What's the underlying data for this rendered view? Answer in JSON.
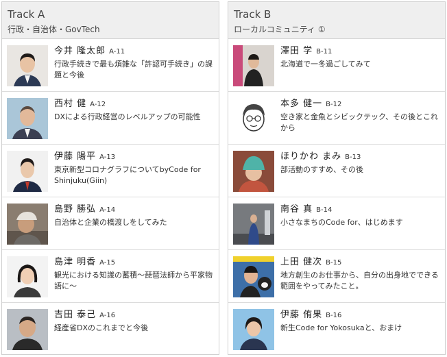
{
  "tracks": [
    {
      "title": "Track A",
      "subtitle": "行政・自治体・GovTech",
      "talks": [
        {
          "name": "今井 隆太郎",
          "code": "A-11",
          "title": "行政手続きで最も煩雑な「許認可手続き」の課題と今後"
        },
        {
          "name": "西村 健",
          "code": "A-12",
          "title": "DXによる行政経営のレベルアップの可能性"
        },
        {
          "name": "伊藤 陽平",
          "code": "A-13",
          "title": "東京新型コロナグラフについてbyCode for Shinjuku(Giin)"
        },
        {
          "name": "島野 勝弘",
          "code": "A-14",
          "title": "自治体と企業の橋渡しをしてみた"
        },
        {
          "name": "島津 明香",
          "code": "A-15",
          "title": "観光における知識の蓄積〜琵琶法師から平家物語に〜"
        },
        {
          "name": "吉田 泰己",
          "code": "A-16",
          "title": "経産省DXのこれまでと今後"
        }
      ]
    },
    {
      "title": "Track B",
      "subtitle": "ローカルコミュニティ ①",
      "talks": [
        {
          "name": "澤田 学",
          "code": "B-11",
          "title": "北海道で一冬過ごしてみて"
        },
        {
          "name": "本多 健一",
          "code": "B-12",
          "title": "空き家と金魚とシビックテック、その後とこれから"
        },
        {
          "name": "ほりかわ まみ",
          "code": "B-13",
          "title": "部活動のすすめ、その後"
        },
        {
          "name": "南谷 真",
          "code": "B-14",
          "title": "小さなまちのCode for、はじめます"
        },
        {
          "name": "上田 健次",
          "code": "B-15",
          "title": "地方創生のお仕事から、自分の出身地でできる範囲をやってみたこと。"
        },
        {
          "name": "伊藤 侑果",
          "code": "B-16",
          "title": "新生Code for Yokosukaと、おまけ"
        }
      ]
    }
  ]
}
